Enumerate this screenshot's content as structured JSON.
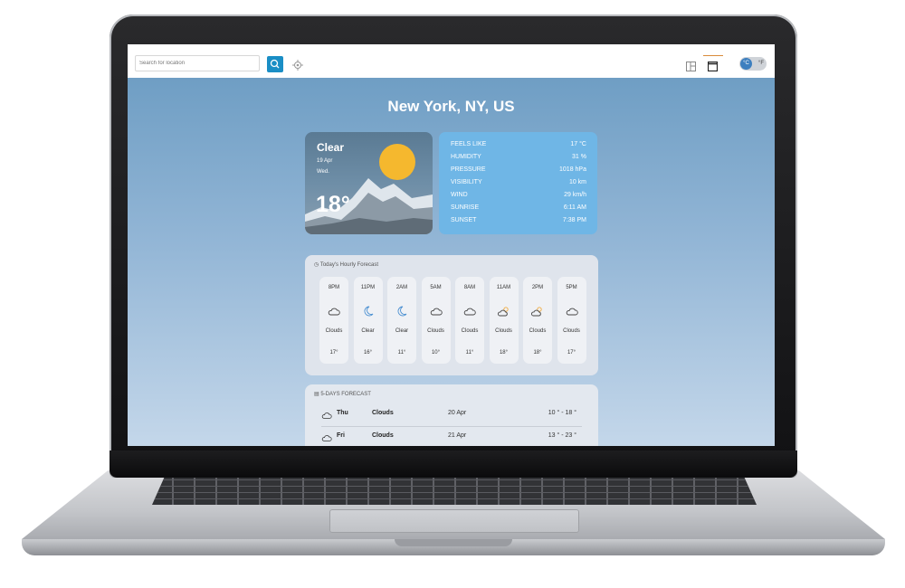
{
  "search": {
    "placeholder": "Search for location"
  },
  "location": {
    "city": "New York, NY, US"
  },
  "current": {
    "condition": "Clear",
    "date": "19 Apr",
    "weekday": "Wed.",
    "temperature": "18°"
  },
  "details": [
    {
      "label": "FEELS LIKE",
      "value": "17 °C"
    },
    {
      "label": "HUMIDITY",
      "value": "31 %"
    },
    {
      "label": "PRESSURE",
      "value": "1018 hPa"
    },
    {
      "label": "VISIBILITY",
      "value": "10 km"
    },
    {
      "label": "WIND",
      "value": "29 km/h"
    },
    {
      "label": "SUNRISE",
      "value": "6:11 AM"
    },
    {
      "label": "SUNSET",
      "value": "7:38 PM"
    }
  ],
  "hourly": {
    "title": "Today's Hourly Forecast",
    "items": [
      {
        "time": "8PM",
        "icon": "cloud-moon-icon",
        "desc": "Clouds",
        "temp": "17°"
      },
      {
        "time": "11PM",
        "icon": "moon-icon",
        "desc": "Clear",
        "temp": "16°"
      },
      {
        "time": "2AM",
        "icon": "moon-icon",
        "desc": "Clear",
        "temp": "11°"
      },
      {
        "time": "5AM",
        "icon": "cloud-icon",
        "desc": "Clouds",
        "temp": "10°"
      },
      {
        "time": "8AM",
        "icon": "cloud-icon",
        "desc": "Clouds",
        "temp": "11°"
      },
      {
        "time": "11AM",
        "icon": "cloud-sun-icon",
        "desc": "Clouds",
        "temp": "18°"
      },
      {
        "time": "2PM",
        "icon": "cloud-sun-icon",
        "desc": "Clouds",
        "temp": "18°"
      },
      {
        "time": "5PM",
        "icon": "cloud-icon",
        "desc": "Clouds",
        "temp": "17°"
      }
    ]
  },
  "daily": {
    "title": "5-DAYS FORECAST",
    "items": [
      {
        "day": "Thu",
        "icon": "cloud-icon",
        "desc": "Clouds",
        "date": "20 Apr",
        "range": "10 ° - 18 °"
      },
      {
        "day": "Fri",
        "icon": "cloud-icon",
        "desc": "Clouds",
        "date": "21 Apr",
        "range": "13 ° - 23 °"
      }
    ]
  },
  "units": {
    "celsius": "°C",
    "fahrenheit": "°F"
  },
  "colors": {
    "accent": "#1a8ec5",
    "sun": "#f5b82e",
    "details_bg": "#6fb6e6"
  }
}
